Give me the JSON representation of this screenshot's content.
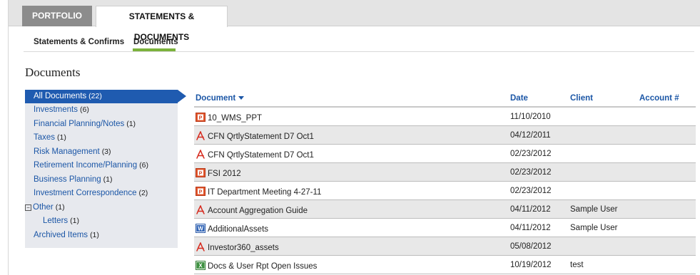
{
  "tabs": [
    {
      "label": "PORTFOLIO",
      "active": false
    },
    {
      "label": "STATEMENTS & DOCUMENTS",
      "active": true
    }
  ],
  "subnav": [
    {
      "label": "Statements & Confirms",
      "active": false
    },
    {
      "label": "Documents",
      "active": true
    }
  ],
  "colors": {
    "accent_green": "#7bb23b",
    "active_blue": "#1f5bb0",
    "link_blue": "#1b56a6"
  },
  "page_title": "Documents",
  "sidebar": {
    "items": [
      {
        "label": "All Documents",
        "count": "(22)"
      },
      {
        "label": "Investments",
        "count": "(6)"
      },
      {
        "label": "Financial Planning/Notes",
        "count": "(1)"
      },
      {
        "label": "Taxes",
        "count": "(1)"
      },
      {
        "label": "Risk Management",
        "count": "(3)"
      },
      {
        "label": "Retirement Income/Planning",
        "count": "(6)"
      },
      {
        "label": "Business Planning",
        "count": "(1)"
      },
      {
        "label": "Investment Correspondence",
        "count": "(2)"
      },
      {
        "label": "Other",
        "count": "(1)",
        "tree_toggle": "⊟"
      },
      {
        "label": "Letters",
        "count": "(1)"
      },
      {
        "label": "Archived Items",
        "count": "(1)"
      }
    ]
  },
  "table": {
    "columns": {
      "document": "Document",
      "date": "Date",
      "client": "Client",
      "account": "Account #"
    },
    "rows": [
      {
        "icon": "ppt-icon",
        "name": "10_WMS_PPT",
        "date": "11/10/2010",
        "client": "",
        "account": ""
      },
      {
        "icon": "pdf-icon",
        "name": "CFN QrtlyStatement D7 Oct1",
        "date": "04/12/2011",
        "client": "",
        "account": ""
      },
      {
        "icon": "pdf-icon",
        "name": "CFN QrtlyStatement D7 Oct1",
        "date": "02/23/2012",
        "client": "",
        "account": ""
      },
      {
        "icon": "ppt-icon",
        "name": "FSI 2012",
        "date": "02/23/2012",
        "client": "",
        "account": ""
      },
      {
        "icon": "ppt-icon",
        "name": "IT Department Meeting 4-27-11",
        "date": "02/23/2012",
        "client": "",
        "account": ""
      },
      {
        "icon": "pdf-icon",
        "name": "Account Aggregation Guide",
        "date": "04/11/2012",
        "client": "Sample User",
        "account": ""
      },
      {
        "icon": "word-icon",
        "name": "AdditionalAssets",
        "date": "04/11/2012",
        "client": "Sample User",
        "account": ""
      },
      {
        "icon": "pdf-icon",
        "name": "Investor360_assets",
        "date": "05/08/2012",
        "client": "",
        "account": ""
      },
      {
        "icon": "excel-icon",
        "name": "Docs & User Rpt Open Issues",
        "date": "10/19/2012",
        "client": "test",
        "account": ""
      }
    ]
  }
}
